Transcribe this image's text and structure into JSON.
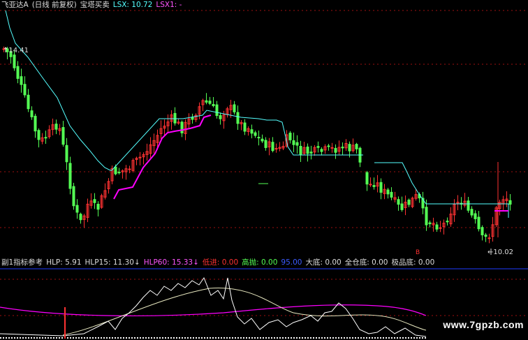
{
  "main_info": {
    "stock_name": "飞亚达A",
    "period_label": "(日线 前复权)",
    "indicator_name": "宝塔买卖",
    "lsx_label": "LSX: 10.72",
    "lsx1_label": "LSX1: -"
  },
  "sub_info": {
    "indicator_title": "副1指标参考",
    "hlp": "HLP: 5.91",
    "hlp15": "HLP15: 11.30↓",
    "hlp60": "HLP60: 15.33↓",
    "dijin": "低进: 0.00",
    "gaopao": "高抛: 0.00",
    "v95": "95.00",
    "dadi": "大底: 0.00",
    "quancang": "全仓底: 0.00",
    "jipin": "极品底: 0.00"
  },
  "price_marks": {
    "high": "14.41",
    "low": "←10.02",
    "marker_text": "B"
  },
  "watermark": "www.7gpzb.com",
  "colors": {
    "up": "#ff3232",
    "down": "#54ff54",
    "tower": "#54ffff",
    "magenta": "#ff00ff",
    "grid": "#a01010",
    "blue": "#1e3cff",
    "white": "#ffffff",
    "yellow": "#ffff50"
  },
  "chart_data": {
    "type": "candlestick",
    "price_high": 14.41,
    "price_low": 10.02,
    "last_lsx": 10.72
  }
}
